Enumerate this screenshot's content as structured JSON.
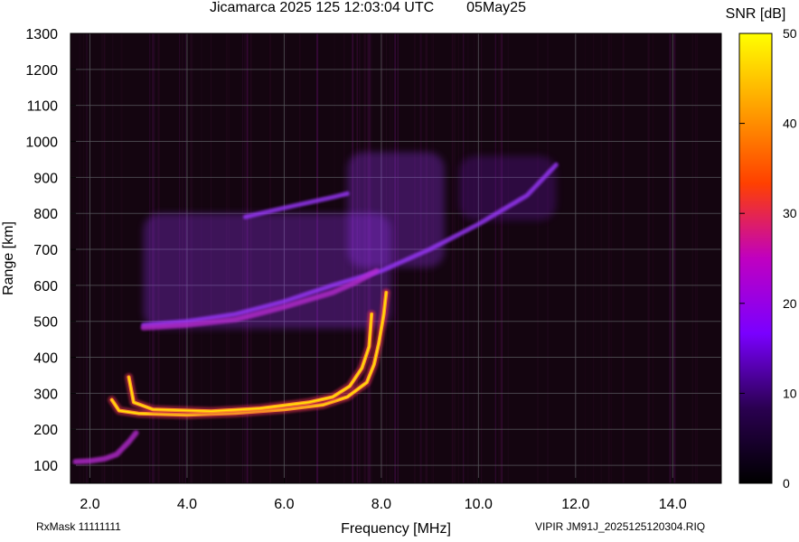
{
  "header": {
    "title": "Jicamarca 2025 125 12:03:04 UTC",
    "date": "05May25"
  },
  "footer": {
    "rx_mask": "RxMask 11111111",
    "file": "VIPIR  JM91J_2025125120304.RIQ"
  },
  "colors": {
    "background": "#140510",
    "grid": "#55555a",
    "faint": "#7a1fd0",
    "weak": "#9b38ff",
    "medium": "#b52ad0",
    "strong": "#e03050",
    "hot": "#ff9a20",
    "max": "#fff000"
  },
  "chart_data": {
    "type": "heatmap",
    "title": "Jicamarca 2025 125 12:03:04 UTC",
    "xlabel": "Frequency [MHz]",
    "ylabel": "Range [km]",
    "xlim": [
      1.6,
      15.0
    ],
    "ylim": [
      50,
      1300
    ],
    "xticks": [
      2.0,
      4.0,
      6.0,
      8.0,
      10.0,
      12.0,
      14.0
    ],
    "xtick_labels": [
      "2.0",
      "4.0",
      "6.0",
      "8.0",
      "10.0",
      "12.0",
      "14.0"
    ],
    "yticks": [
      100,
      200,
      300,
      400,
      500,
      600,
      700,
      800,
      900,
      1000,
      1100,
      1200,
      1300
    ],
    "ytick_labels": [
      "100",
      "200",
      "300",
      "400",
      "500",
      "600",
      "700",
      "800",
      "900",
      "1000",
      "1100",
      "1200",
      "1300"
    ],
    "colorbar": {
      "label": "SNR [dB]",
      "range": [
        0,
        50
      ],
      "ticks": [
        0,
        10,
        20,
        30,
        40,
        50
      ],
      "tick_labels": [
        "0",
        "10",
        "20",
        "30",
        "40",
        "50"
      ],
      "stops": [
        "#000000",
        "#2a0050",
        "#7a00ff",
        "#c000c0",
        "#ff4000",
        "#ffa000",
        "#ffff00"
      ]
    },
    "grid": true,
    "traces": [
      {
        "name": "O-mode F trace",
        "snr": "high",
        "points": [
          [
            2.45,
            282
          ],
          [
            2.6,
            252
          ],
          [
            3.0,
            244
          ],
          [
            4.0,
            240
          ],
          [
            5.0,
            245
          ],
          [
            6.0,
            255
          ],
          [
            6.8,
            268
          ],
          [
            7.3,
            290
          ],
          [
            7.7,
            330
          ],
          [
            7.85,
            380
          ],
          [
            7.95,
            440
          ],
          [
            8.05,
            520
          ],
          [
            8.1,
            580
          ]
        ]
      },
      {
        "name": "X-mode F trace",
        "snr": "high",
        "points": [
          [
            2.8,
            345
          ],
          [
            2.9,
            275
          ],
          [
            3.3,
            255
          ],
          [
            4.5,
            250
          ],
          [
            5.5,
            258
          ],
          [
            6.5,
            275
          ],
          [
            7.0,
            290
          ],
          [
            7.35,
            320
          ],
          [
            7.6,
            370
          ],
          [
            7.75,
            430
          ],
          [
            7.8,
            520
          ]
        ]
      },
      {
        "name": "Low-range trace",
        "snr": "medium",
        "points": [
          [
            1.7,
            110
          ],
          [
            2.0,
            112
          ],
          [
            2.3,
            118
          ],
          [
            2.55,
            130
          ],
          [
            2.8,
            165
          ],
          [
            2.95,
            190
          ]
        ]
      },
      {
        "name": "Second-hop upper boundary",
        "snr": "low",
        "points": [
          [
            3.1,
            490
          ],
          [
            4.0,
            500
          ],
          [
            5.0,
            520
          ],
          [
            6.0,
            555
          ],
          [
            7.0,
            600
          ],
          [
            8.0,
            640
          ],
          [
            9.0,
            700
          ],
          [
            10.0,
            770
          ],
          [
            11.0,
            850
          ],
          [
            11.6,
            935
          ]
        ]
      },
      {
        "name": "Second-hop lower boundary",
        "snr": "medium",
        "points": [
          [
            3.1,
            482
          ],
          [
            4.0,
            490
          ],
          [
            5.0,
            505
          ],
          [
            6.0,
            540
          ],
          [
            7.0,
            580
          ],
          [
            7.5,
            610
          ],
          [
            7.9,
            640
          ]
        ]
      },
      {
        "name": "Third-hop trace",
        "snr": "low",
        "points": [
          [
            5.2,
            790
          ],
          [
            6.0,
            815
          ],
          [
            7.0,
            845
          ],
          [
            7.3,
            855
          ]
        ]
      }
    ],
    "regions": [
      {
        "name": "Second-hop spread",
        "x": [
          3.1,
          8.2
        ],
        "y": [
          480,
          800
        ],
        "snr": "low"
      },
      {
        "name": "Upper spread",
        "x": [
          7.3,
          9.3
        ],
        "y": [
          650,
          970
        ],
        "snr": "low"
      },
      {
        "name": "Faint echo",
        "x": [
          9.6,
          11.6
        ],
        "y": [
          780,
          960
        ],
        "snr": "faint"
      }
    ]
  }
}
